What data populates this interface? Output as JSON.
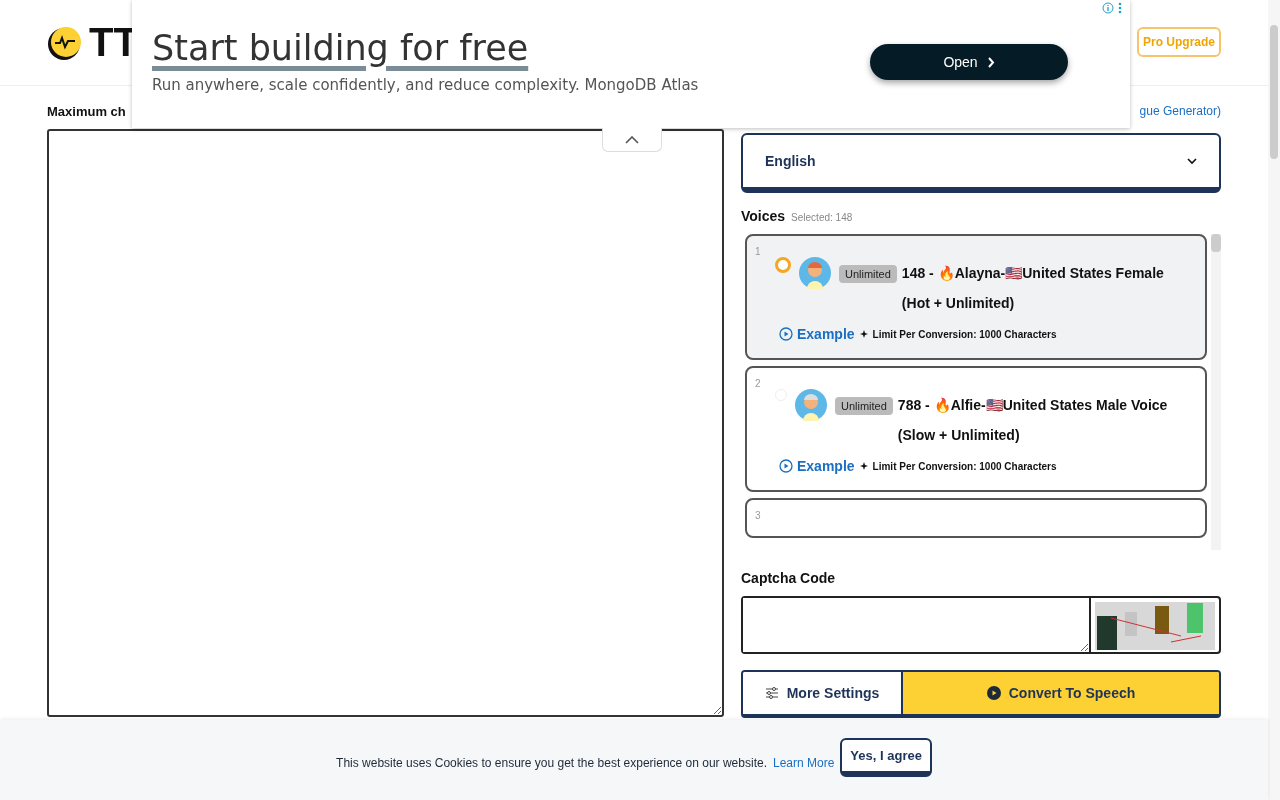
{
  "header": {
    "logo_text": "TT",
    "upgrade_button": "Pro Upgrade"
  },
  "ad": {
    "headline": "Start building for free",
    "tagline": "Run anywhere, scale confidently, and reduce complexity. MongoDB Atlas",
    "button": "Open"
  },
  "editor": {
    "label": "Maximum ch",
    "link": "gue Generator)"
  },
  "language": {
    "value": "English"
  },
  "voices": {
    "title": "Voices",
    "selected_note": "Selected: 148",
    "items": [
      {
        "index": "1",
        "selected": true,
        "badge": "Unlimited",
        "name": "148 - 🔥Alayna-🇺🇸United States Female (Hot + Unlimited)",
        "example": "Example",
        "limit": "Limit Per Conversion: 1000 Characters"
      },
      {
        "index": "2",
        "selected": false,
        "badge": "Unlimited",
        "name": "788 - 🔥Alfie-🇺🇸United States Male Voice (Slow + Unlimited)",
        "example": "Example",
        "limit": "Limit Per Conversion: 1000 Characters"
      },
      {
        "index": "3",
        "selected": false
      }
    ]
  },
  "captcha": {
    "label": "Captcha Code"
  },
  "actions": {
    "settings": "More Settings",
    "convert": "Convert To Speech"
  },
  "cookie": {
    "text": "This website uses Cookies to ensure you get the best experience on our website.",
    "link": "Learn More",
    "button": "Yes, I agree"
  }
}
